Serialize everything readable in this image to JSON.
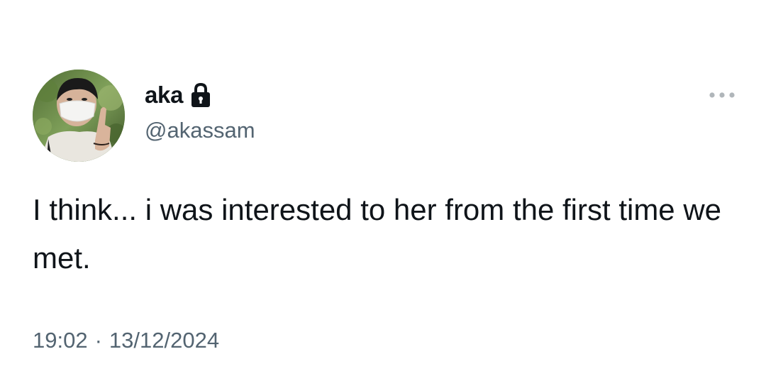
{
  "tweet": {
    "author": {
      "display_name": "aka",
      "handle": "@akassam",
      "protected_icon": "lock-icon",
      "avatar": "profile-photo"
    },
    "menu_icon": "more-horizontal-icon",
    "text": "I think... i was interested to her from the first time we met.",
    "time": "19:02",
    "separator": "·",
    "date": "13/12/2024"
  },
  "colors": {
    "text_primary": "#0f1419",
    "text_secondary": "#536471",
    "background": "#ffffff"
  }
}
